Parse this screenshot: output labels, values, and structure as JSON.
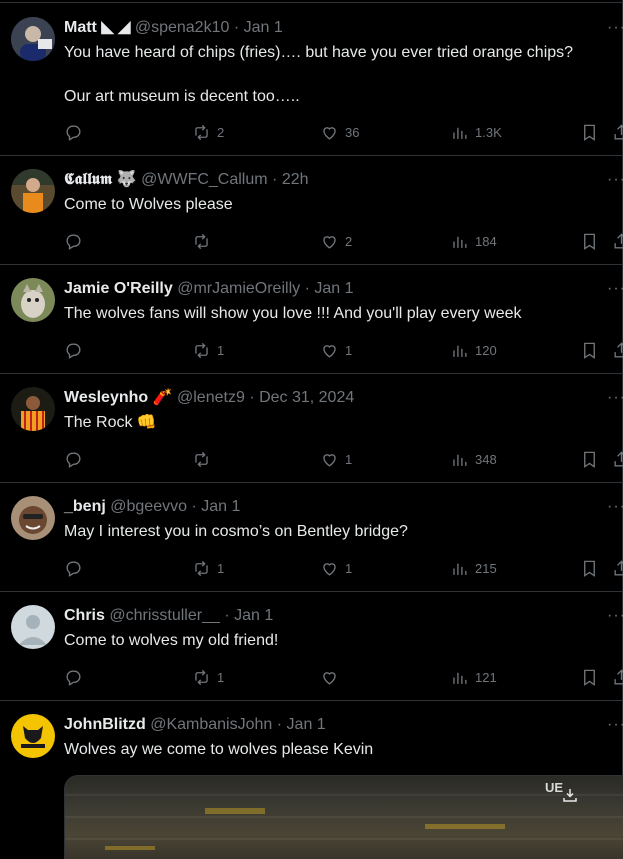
{
  "tweets": [
    {
      "name": "Matt",
      "suffix": " ◣ ◢",
      "handle": "@spena2k10",
      "time": "· Jan 1",
      "lines": [
        "You have heard of chips (fries)…. but have you ever tried orange chips?",
        "",
        "Our art museum is decent too….."
      ],
      "replies": "",
      "retweets": "2",
      "likes": "36",
      "views": "1.3K",
      "avatar_color": "#3a3f4a"
    },
    {
      "name": "𝕮𝖆𝖑𝖑𝖚𝖒",
      "suffix": " 🐺",
      "handle": "@WWFC_Callum",
      "time": "· 22h",
      "lines": [
        "Come to Wolves please"
      ],
      "replies": "",
      "retweets": "",
      "likes": "2",
      "views": "184",
      "avatar_color": "#6b5a3a"
    },
    {
      "name": "Jamie O'Reilly",
      "suffix": "",
      "handle": "@mrJamieOreilly",
      "time": "· Jan 1",
      "lines": [
        "The wolves fans will show you love !!! And you'll play every week"
      ],
      "replies": "",
      "retweets": "1",
      "likes": "1",
      "views": "120",
      "avatar_color": "#8f8a72"
    },
    {
      "name": "Wesleynho",
      "suffix": " 🧨",
      "handle": "@lenetz9",
      "time": "· Dec 31, 2024",
      "lines": [
        "The Rock 👊"
      ],
      "replies": "",
      "retweets": "",
      "likes": "1",
      "views": "348",
      "avatar_color": "#c98a1e"
    },
    {
      "name": "_benj",
      "suffix": "",
      "handle": "@bgeevvo",
      "time": "· Jan 1",
      "lines": [
        "May I interest you in cosmo’s on Bentley bridge?"
      ],
      "replies": "",
      "retweets": "1",
      "likes": "1",
      "views": "215",
      "avatar_color": "#7a5a45"
    },
    {
      "name": "Chris",
      "suffix": "",
      "handle": "@chrisstuller__",
      "time": "· Jan 1",
      "lines": [
        "Come to wolves my old friend!"
      ],
      "replies": "",
      "retweets": "1",
      "likes": "",
      "views": "121",
      "avatar_color": "#cfd9de"
    },
    {
      "name": "JohnBlitzd",
      "suffix": "",
      "handle": "@KambanisJohn",
      "time": "· Jan 1",
      "lines": [
        "Wolves ay we come to wolves please Kevin"
      ],
      "replies": "",
      "retweets": "",
      "likes": "",
      "views": "",
      "avatar_color": "#f5c400"
    }
  ],
  "media": {
    "badge": "UE"
  },
  "icons": {
    "reply": "reply-icon",
    "retweet": "retweet-icon",
    "like": "heart-icon",
    "views": "views-icon",
    "bookmark": "bookmark-icon",
    "share": "share-icon",
    "more": "more-icon"
  }
}
